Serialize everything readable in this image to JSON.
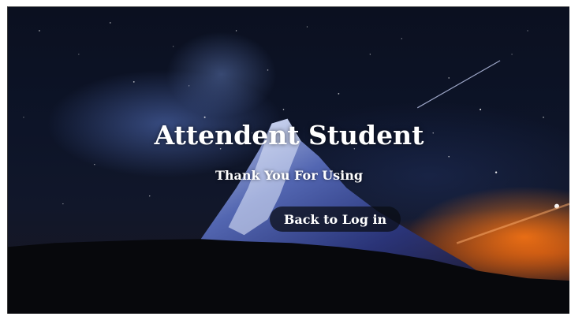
{
  "page": {
    "title": "Attendent Student",
    "subtitle": "Thank You For Using",
    "back_button_label": "Back to Log in"
  },
  "colors": {
    "text": "#ffffff",
    "button_background": "#0a0c14",
    "sky": "#0b1020",
    "sunset_glow": "#ff7814"
  }
}
